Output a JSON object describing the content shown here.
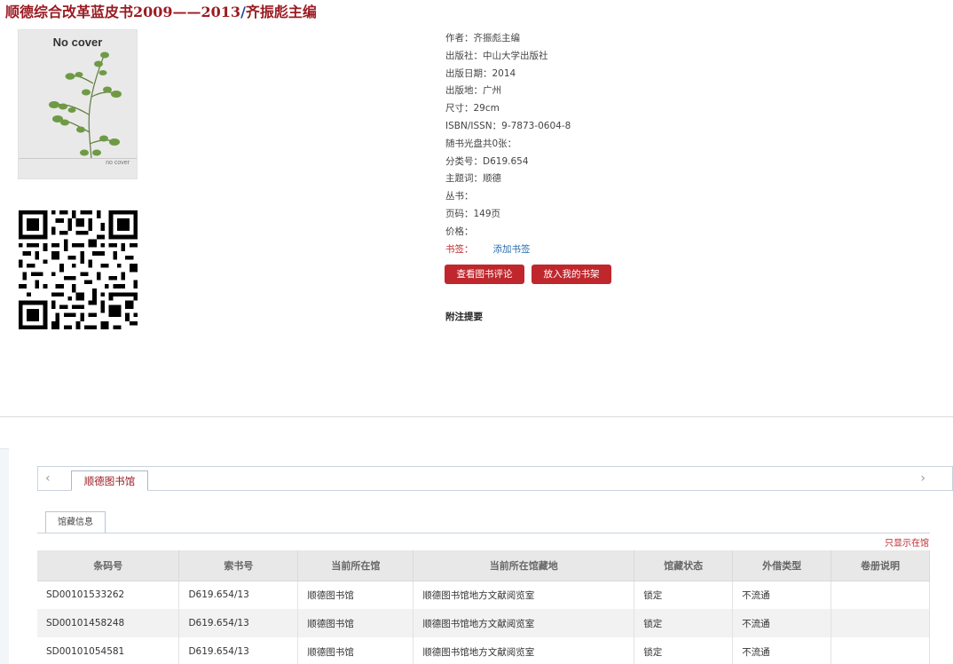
{
  "book": {
    "title_main": "顺德综合改革蓝皮书2009——2013",
    "title_sep": "/",
    "title_author": "齐振彪主编",
    "cover_text_top": "No cover",
    "cover_text_bottom": "no cover"
  },
  "meta": {
    "author": "作者：齐振彪主编",
    "publisher": "出版社：中山大学出版社",
    "pub_date": "出版日期：2014",
    "pub_place": "出版地：广州",
    "size": "尺寸：29cm",
    "isbn": "ISBN/ISSN：9-7873-0604-8",
    "cd": "随书光盘共0张：",
    "classification": "分类号：D619.654",
    "subject": "主题词：顺德",
    "series": "丛书：",
    "pages": "页码：149页",
    "price": "价格：",
    "bookmark_label": "书签：",
    "bookmark_link": "添加书签"
  },
  "buttons": {
    "review": "查看图书评论",
    "shelf": "放入我的书架"
  },
  "abstract_heading": "附注提要",
  "tabs": {
    "library": "顺德图书馆",
    "holdings": "馆藏信息",
    "only_show": "只显示在馆"
  },
  "table": {
    "headers": [
      "条码号",
      "索书号",
      "当前所在馆",
      "当前所在馆藏地",
      "馆藏状态",
      "外借类型",
      "卷册说明"
    ],
    "rows": [
      [
        "SD00101533262",
        "D619.654/13",
        "顺德图书馆",
        "顺德图书馆地方文献阅览室",
        "锁定",
        "不流通",
        ""
      ],
      [
        "SD00101458248",
        "D619.654/13",
        "顺德图书馆",
        "顺德图书馆地方文献阅览室",
        "锁定",
        "不流通",
        ""
      ],
      [
        "SD00101054581",
        "D619.654/13",
        "顺德图书馆",
        "顺德图书馆地方文献阅览室",
        "锁定",
        "不流通",
        ""
      ]
    ]
  },
  "icons": {
    "prev": "chevron-left-icon",
    "next": "chevron-right-icon"
  }
}
